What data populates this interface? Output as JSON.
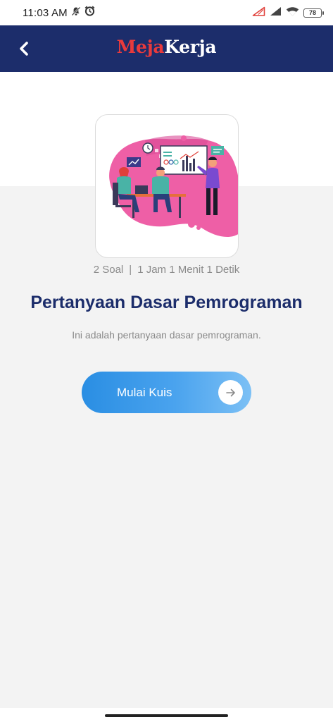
{
  "status_bar": {
    "time": "11:03 AM",
    "battery": "78",
    "icons": [
      "notification-off-icon",
      "alarm-icon",
      "signal-warning-icon",
      "cellular-signal-icon",
      "wifi-icon",
      "battery-icon"
    ]
  },
  "app_bar": {
    "brand_part1": "Meja",
    "brand_part2": "Kerja",
    "brand_colors": {
      "part1": "#e93a3c",
      "part2": "#ffffff"
    },
    "background": "#1c2d6b",
    "back_icon": "chevron-left-icon"
  },
  "quiz": {
    "question_count": "2 Soal",
    "separator": "|",
    "duration": "1 Jam 1 Menit 1 Detik",
    "title": "Pertanyaan Dasar Pemrograman",
    "description": "Ini adalah pertanyaan dasar pemrograman.",
    "start_label": "Mulai Kuis",
    "start_icon": "arrow-right-icon"
  }
}
